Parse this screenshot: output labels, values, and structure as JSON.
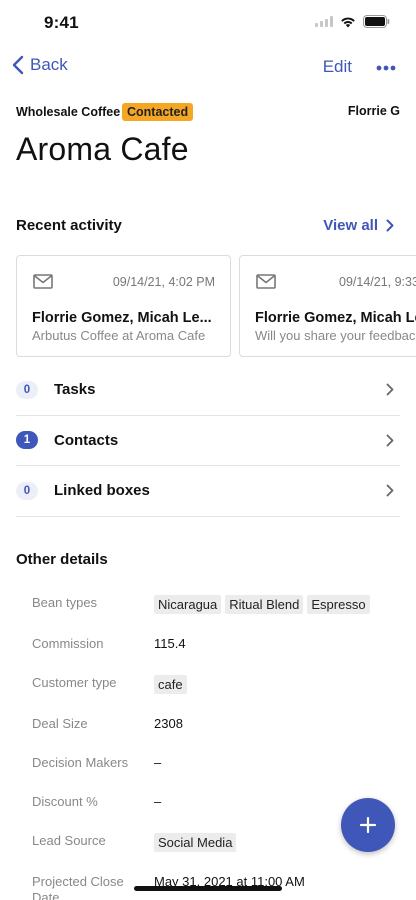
{
  "status_bar": {
    "time": "9:41"
  },
  "nav": {
    "back_label": "Back",
    "edit_label": "Edit"
  },
  "header": {
    "pipeline": "Wholesale Coffee",
    "stage": "Contacted",
    "assignee": "Florrie G",
    "title": "Aroma Cafe"
  },
  "recent_activity": {
    "label": "Recent activity",
    "view_all": "View all",
    "cards": [
      {
        "date": "09/14/21, 4:02 PM",
        "subject": "Florrie Gomez, Micah Le...",
        "preview": "Arbutus Coffee at Aroma Cafe"
      },
      {
        "date": "09/14/21, 9:33",
        "subject": "Florrie Gomez, Micah Le",
        "preview": "Will you share your feedback"
      }
    ]
  },
  "links": [
    {
      "count": "0",
      "label": "Tasks"
    },
    {
      "count": "1",
      "label": "Contacts"
    },
    {
      "count": "0",
      "label": "Linked boxes"
    }
  ],
  "other_details": {
    "label": "Other details",
    "fields": {
      "bean_types": {
        "label": "Bean types",
        "tags": [
          "Nicaragua",
          "Ritual Blend",
          "Espresso"
        ]
      },
      "commission": {
        "label": "Commission",
        "value": "115.4"
      },
      "customer_type": {
        "label": "Customer type",
        "tag": "cafe"
      },
      "deal_size": {
        "label": "Deal Size",
        "value": "2308"
      },
      "decision_makers": {
        "label": "Decision Makers",
        "value": "–"
      },
      "discount": {
        "label": "Discount %",
        "value": "–"
      },
      "lead_source": {
        "label": "Lead Source",
        "tag": "Social Media"
      },
      "projected_close": {
        "label": "Projected Close Date",
        "value": "May 31, 2021 at 11:00 AM"
      }
    }
  },
  "colors": {
    "accent": "#3f57b8",
    "stage_badge": "#f5a623"
  }
}
